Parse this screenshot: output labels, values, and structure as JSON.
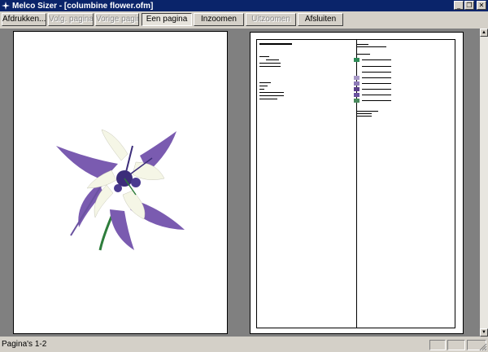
{
  "window": {
    "title": "Melco Sizer - [columbine flower.ofm]"
  },
  "toolbar": {
    "print_label": "Afdrukken...",
    "next_page_label": "Volg. pagina",
    "prev_page_label": "Vorige pagina",
    "one_page_label": "Een pagina",
    "zoom_in_label": "Inzoomen",
    "zoom_out_label": "Uitzoomen",
    "close_label": "Afsluiten"
  },
  "status": {
    "text": "Pagina's 1-2"
  },
  "colors": {
    "title_bar": "#0a246a",
    "flower_purple": "#7a5bb0",
    "flower_dark_purple": "#3c2d7a",
    "petal_white": "#f5f6e6",
    "stem_green": "#2e7d3c"
  },
  "report_swatches": [
    "#2e8b57",
    "#8e7bb8",
    "#a899c8",
    "#5a3f8a",
    "#6a52a0",
    "#4a8a5e",
    "#7d6aaa",
    "#6b5e9a"
  ]
}
